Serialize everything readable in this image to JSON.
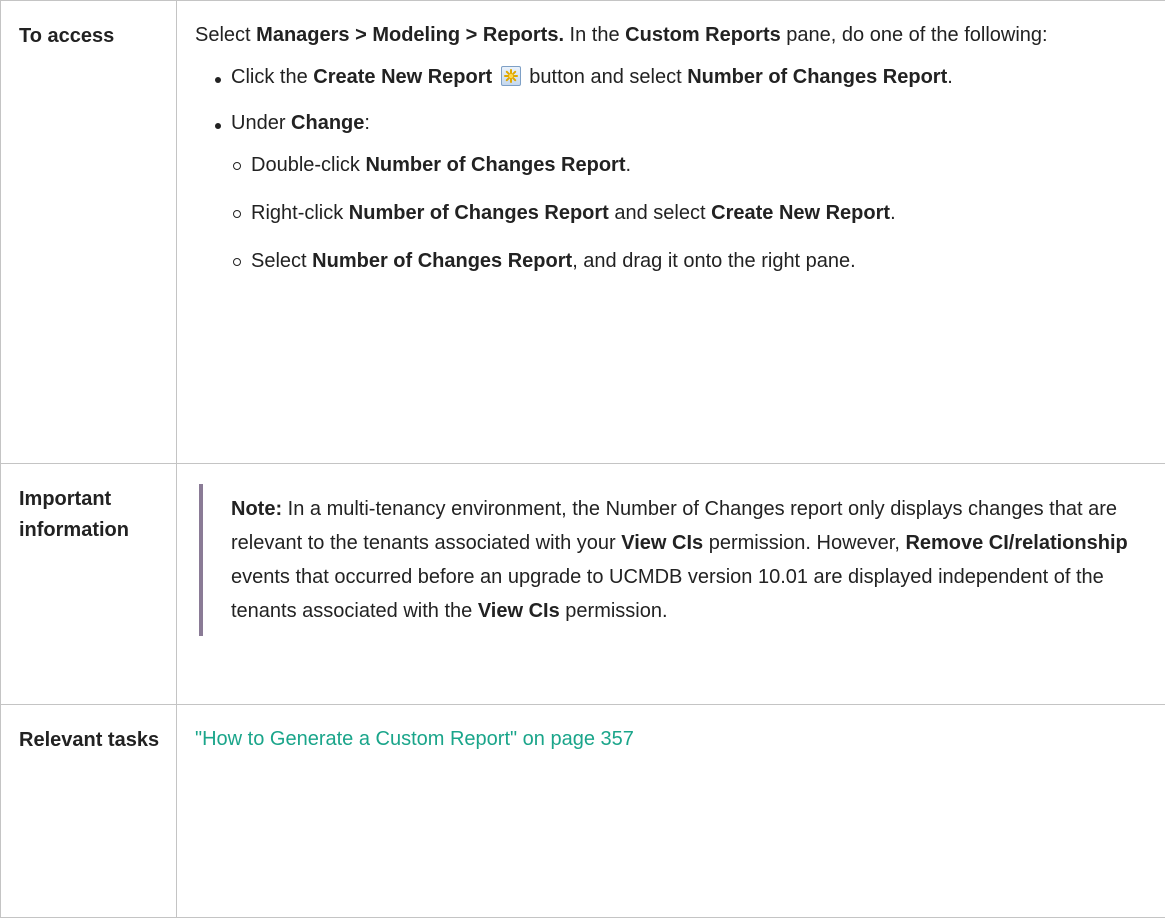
{
  "rows": [
    {
      "label": "To access",
      "intro": {
        "t1": "Select ",
        "path": "Managers > Modeling > Reports.",
        "t2": " In the ",
        "pane": "Custom Reports",
        "t3": " pane, do one of the following:"
      },
      "bullet1": {
        "t1": "Click the ",
        "button": "Create New Report",
        "icon": "create-new-report-icon",
        "t2": " button and select ",
        "report": "Number of Changes Report",
        "t3": "."
      },
      "bullet2": {
        "t1": "Under ",
        "change": "Change",
        "t2": ":"
      },
      "sub": [
        {
          "t1": "Double-click ",
          "b1": "Number of Changes Report",
          "t2": "."
        },
        {
          "t1": "Right-click ",
          "b1": "Number of Changes Report",
          "t2": " and select ",
          "b2": "Create New Report",
          "t3": "."
        },
        {
          "t1": "Select ",
          "b1": "Number of Changes Report",
          "t2": ", and drag it onto the right pane."
        }
      ]
    },
    {
      "label": "Important information",
      "note": {
        "title": "Note:",
        "t1": "  In a multi-tenancy environment, the Number of Changes report only displays changes that are relevant to the tenants associated with your ",
        "b1": "View CIs",
        "t2": " permission. However, ",
        "b2": "Remove CI/relationship",
        "t3": " events that occurred before an upgrade to UCMDB version 10.01 are displayed independent of the tenants associated with the ",
        "b3": "View CIs",
        "t4": " permission."
      }
    },
    {
      "label": "Relevant tasks",
      "link": "\"How to Generate a Custom Report\" on page 357"
    }
  ],
  "colors": {
    "border": "#c4c4c4",
    "text": "#222222",
    "link": "#1aa58a",
    "note_bar": "#8a7b96"
  }
}
